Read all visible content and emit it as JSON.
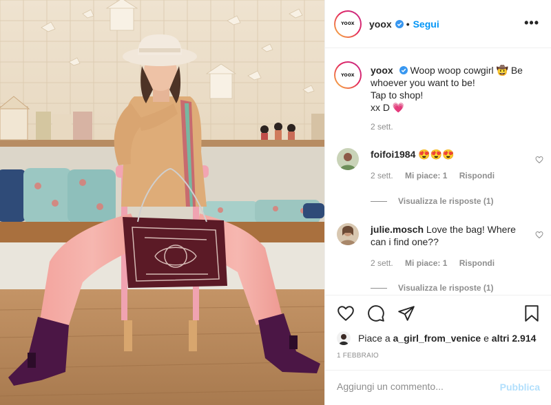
{
  "post": {
    "username": "yoox",
    "avatar_logo": "YOOX",
    "follow_label": "Segui",
    "separator": "•",
    "more_label": "•••",
    "caption": {
      "username": "yoox",
      "text_line1": "Woop woop cowgirl 🤠 Be whoever you want to be!",
      "text_line2": "Tap to shop!",
      "text_line3": "xx D 💗",
      "time": "2 sett."
    },
    "comments": [
      {
        "username": "foifoi1984",
        "text": "😍😍😍",
        "time": "2 sett.",
        "likes": "Mi piace: 1",
        "reply": "Rispondi",
        "view_replies": "Visualizza le risposte (1)"
      },
      {
        "username": "julie.mosch",
        "text": "Love the bag! Where can i find one??",
        "time": "2 sett.",
        "likes": "Mi piace: 1",
        "reply": "Rispondi",
        "view_replies": "Visualizza le risposte (1)"
      }
    ],
    "liked_by_prefix": "Piace a",
    "liked_by_user": "a_girl_from_venice",
    "liked_by_and": "e",
    "liked_by_others": "altri 2.914",
    "date": "1 FEBBRAIO",
    "add_comment_placeholder": "Aggiungi un commento...",
    "publish_label": "Pubblica"
  },
  "icons": {
    "verified": "verified-badge-icon",
    "like": "heart-icon",
    "comment": "comment-bubble-icon",
    "share": "paper-plane-icon",
    "save": "bookmark-icon"
  },
  "colors": {
    "accent": "#0095f6",
    "publish_disabled": "#b2dffc",
    "secondary_text": "#8e8e8e"
  }
}
